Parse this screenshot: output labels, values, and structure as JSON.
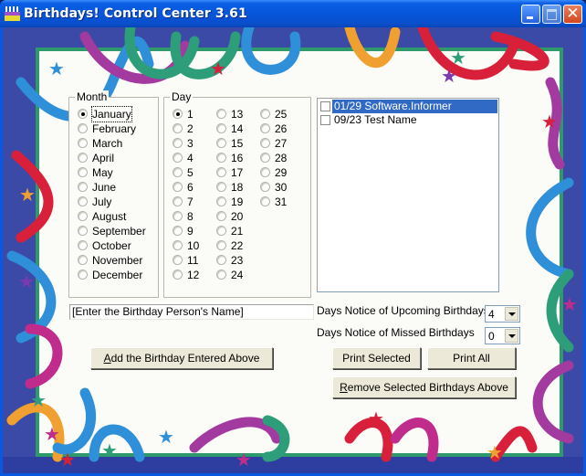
{
  "window": {
    "title": "Birthdays! Control Center 3.61",
    "app_icon": "birthday-cake-icon",
    "controls": {
      "minimize": "minimize-icon",
      "maximize": "maximize-icon",
      "close": "close-icon",
      "close_glyph": "✕"
    }
  },
  "month_group": {
    "title": "Month",
    "selected": "January",
    "items": [
      "January",
      "February",
      "March",
      "April",
      "May",
      "June",
      "July",
      "August",
      "September",
      "October",
      "November",
      "December"
    ]
  },
  "day_group": {
    "title": "Day",
    "selected": "1",
    "items": [
      "1",
      "2",
      "3",
      "4",
      "5",
      "6",
      "7",
      "8",
      "9",
      "10",
      "11",
      "12",
      "13",
      "14",
      "15",
      "16",
      "17",
      "18",
      "19",
      "20",
      "21",
      "22",
      "23",
      "24",
      "25",
      "26",
      "27",
      "28",
      "29",
      "30",
      "31"
    ]
  },
  "birthday_list": {
    "items": [
      {
        "text": "01/29 Software.Informer",
        "checked": false,
        "selected": true
      },
      {
        "text": "09/23 Test Name",
        "checked": false,
        "selected": false
      }
    ]
  },
  "name_input": {
    "value": "[Enter the Birthday Person's Name]"
  },
  "notice": {
    "upcoming_label": "Days Notice of Upcoming Birthdays",
    "upcoming_value": "4",
    "missed_label": "Days Notice of Missed Birthdays",
    "missed_value": "0"
  },
  "buttons": {
    "add": {
      "mnemonic": "A",
      "rest": "dd the Birthday Entered Above"
    },
    "print_selected": "Print Selected",
    "print_all": "Print All",
    "remove": {
      "mnemonic": "R",
      "rest": "emove Selected Birthdays Above"
    }
  },
  "colors": {
    "title_bar": "#0656db",
    "selection": "#316ac5",
    "card_border": "#2e9a6c",
    "frame": "#3b4aa6",
    "button_face": "#ece9d8"
  }
}
